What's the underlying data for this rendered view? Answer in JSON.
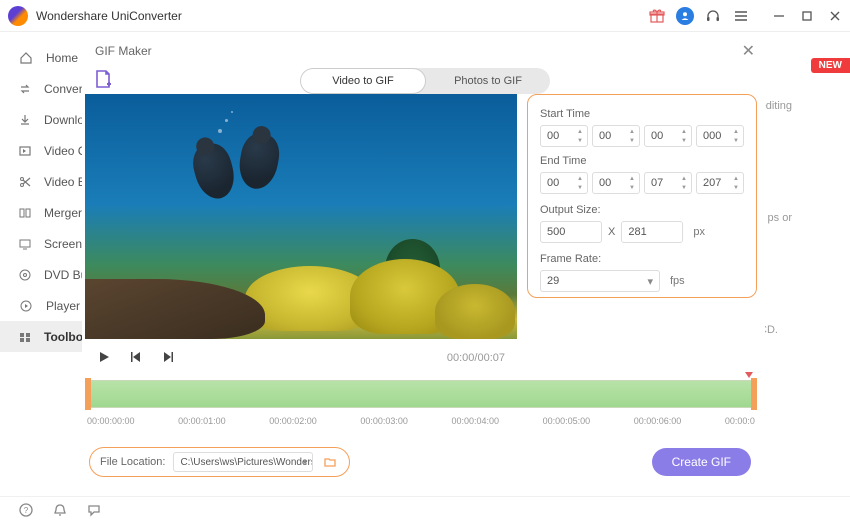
{
  "app": {
    "title": "Wondershare UniConverter"
  },
  "sidebar": {
    "items": [
      {
        "label": "Home"
      },
      {
        "label": "Convert"
      },
      {
        "label": "Download"
      },
      {
        "label": "Video Compressor"
      },
      {
        "label": "Video Editor"
      },
      {
        "label": "Merger"
      },
      {
        "label": "Screen Recorder"
      },
      {
        "label": "DVD Burner"
      },
      {
        "label": "Player"
      },
      {
        "label": "Toolbox"
      }
    ]
  },
  "badge_new": "NEW",
  "bg": {
    "t1": "editing",
    "t2": "ps or",
    "t3": "CD."
  },
  "dialog": {
    "title": "GIF Maker",
    "tabs": {
      "video": "Video to GIF",
      "photos": "Photos to GIF"
    },
    "controls": {
      "playtime": "00:00/00:07"
    },
    "params": {
      "start_label": "Start Time",
      "start": {
        "hh": "00",
        "mm": "00",
        "ss": "00",
        "ms": "000"
      },
      "end_label": "End Time",
      "end": {
        "hh": "00",
        "mm": "00",
        "ss": "07",
        "ms": "207"
      },
      "output_label": "Output Size:",
      "out_w": "500",
      "out_h": "281",
      "out_unit": "px",
      "x": "X",
      "framerate_label": "Frame Rate:",
      "fps_value": "29",
      "fps_unit": "fps"
    },
    "ticks": [
      "00:00:00:00",
      "00:00:01:00",
      "00:00:02:00",
      "00:00:03:00",
      "00:00:04:00",
      "00:00:05:00",
      "00:00:06:00",
      "00:00:0"
    ],
    "fileloc_label": "File Location:",
    "fileloc_path": "C:\\Users\\ws\\Pictures\\Wondersh",
    "create_label": "Create GIF"
  }
}
